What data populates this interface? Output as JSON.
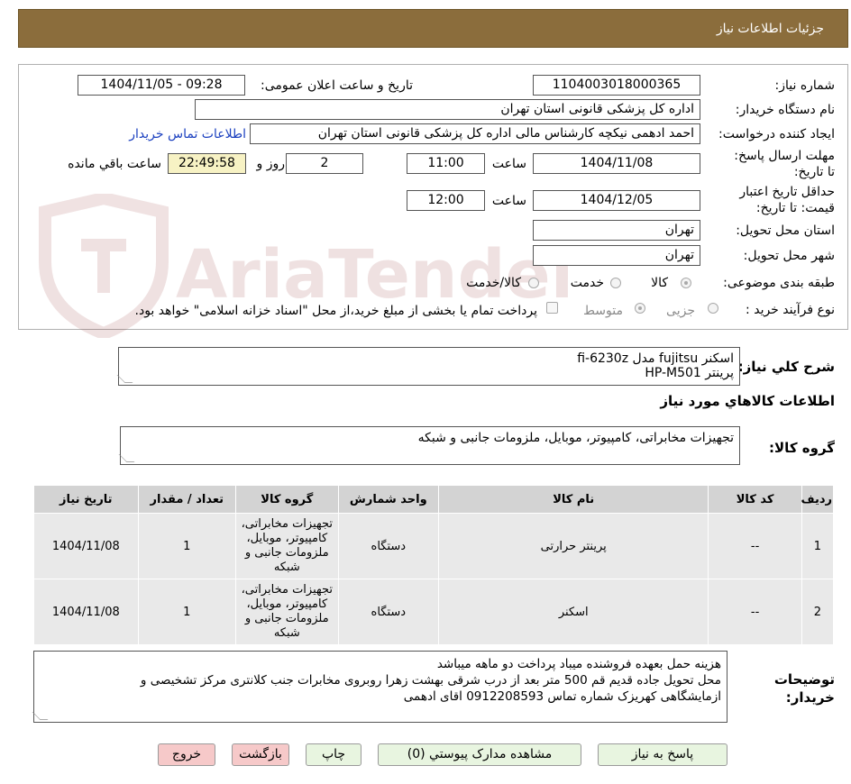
{
  "header": {
    "title": "جزئیات اطلاعات نیاز"
  },
  "form": {
    "need_number": {
      "label": "شماره نیاز:",
      "value": "1104003018000365"
    },
    "announce_datetime": {
      "label": "تاریخ و ساعت اعلان عمومی:",
      "value": "1404/11/05 - 09:28"
    },
    "buyer_org": {
      "label": "نام دستگاه خریدار:",
      "value": "اداره کل پزشکی قانونی استان تهران"
    },
    "requester": {
      "label": "ایجاد کننده درخواست:",
      "value": "احمد ادهمی نیکچه کارشناس مالی اداره کل پزشکی قانونی استان تهران",
      "contact_link": "اطلاعات تماس خریدار"
    },
    "reply_deadline": {
      "label": "مهلت ارسال پاسخ: تا تاریخ:",
      "date": "1404/11/08",
      "time_label": "ساعت",
      "time": "11:00",
      "days": "2",
      "days_label": "روز و",
      "remaining": "22:49:58",
      "remaining_label": "ساعت باقي مانده"
    },
    "price_validity": {
      "label": "حداقل تاریخ اعتبار قیمت: تا تاریخ:",
      "date": "1404/12/05",
      "time_label": "ساعت",
      "time": "12:00"
    },
    "province": {
      "label": "استان محل تحویل:",
      "value": "تهران"
    },
    "city": {
      "label": "شهر محل تحویل:",
      "value": "تهران"
    },
    "category": {
      "label": "طبقه بندی موضوعی:",
      "options": [
        "کالا",
        "خدمت",
        "کالا/خدمت"
      ],
      "selected": "کالا"
    },
    "purchase_process": {
      "label": "نوع فرآیند خرید :",
      "options": [
        "جزیی",
        "متوسط"
      ],
      "selected": "جزیی",
      "checkbox_text": "پرداخت تمام یا بخشی از مبلغ خرید،از محل \"اسناد خزانه اسلامی\" خواهد بود."
    }
  },
  "watermark": {
    "text": "AriaTender.neT"
  },
  "summary": {
    "label": "شرح کلي نياز:",
    "line1": "اسکنر fujitsu مدل fi-6230z",
    "line2": "پرينتر HP-M501"
  },
  "goods_info_title": "اطلاعات کالاهاي مورد نياز",
  "goods_group": {
    "label": "گروه کالا:",
    "value": "تجهیزات مخابراتی، کامپیوتر، موبایل، ملزومات جانبی و شبکه"
  },
  "table": {
    "headers": [
      "ردیف",
      "کد کالا",
      "نام کالا",
      "واحد شمارش",
      "گروه کالا",
      "تعداد / مقدار",
      "تاریخ نیاز"
    ],
    "rows": [
      {
        "row": "1",
        "code": "--",
        "name": "پرینتر حرارتی",
        "unit": "دستگاه",
        "group": "تجهیزات مخابراتی، کامپیوتر، موبایل، ملزومات جانبی و شبکه",
        "qty": "1",
        "date": "1404/11/08"
      },
      {
        "row": "2",
        "code": "--",
        "name": "اسکنر",
        "unit": "دستگاه",
        "group": "تجهیزات مخابراتی، کامپیوتر، موبایل، ملزومات جانبی و شبکه",
        "qty": "1",
        "date": "1404/11/08"
      }
    ]
  },
  "buyer_notes": {
    "label": "توضیحات خریدار:",
    "line1": "هزینه حمل بعهده فروشنده میباد پرداخت دو ماهه میباشد",
    "line2": "محل تحویل جاده قدیم قم 500 متر بعد از درب شرقی بهشت زهرا روبروی مخابرات جنب کلانتری مرکز تشخیصی و",
    "line3": "ازمایشگاهی کهریزک شماره تماس 0912208593 اقای ادهمی"
  },
  "buttons": {
    "reply": "پاسخ به نیاز",
    "attachments": "مشاهده مدارک پیوستي (0)",
    "print": "چاپ",
    "back": "بازگشت",
    "exit": "خروج"
  },
  "colors": {
    "header_bg": "#8b6d3c",
    "button_bg": "#e8f5e0",
    "button_pink": "#f6c9c9",
    "link": "#1a3fbf",
    "remaining_bg": "#f7f2c4",
    "table_header": "#d3d3d3",
    "table_cell": "#e9e9e9"
  }
}
